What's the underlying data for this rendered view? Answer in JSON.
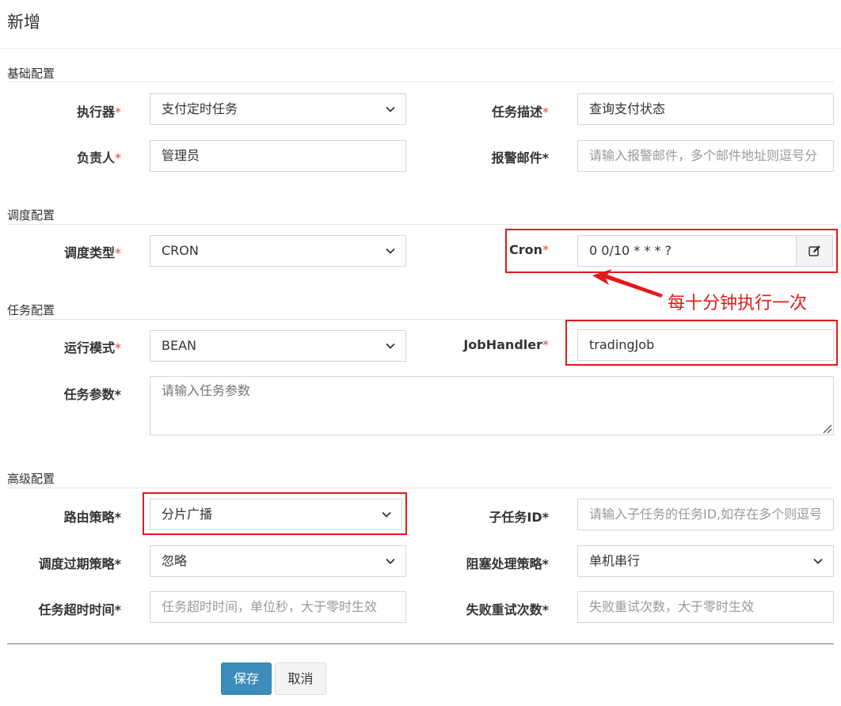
{
  "dialog": {
    "title": "新增"
  },
  "sections": {
    "basic": "基础配置",
    "schedule": "调度配置",
    "task": "任务配置",
    "advanced": "高级配置"
  },
  "required_mark": "*",
  "fields": {
    "executor": {
      "label": "执行器",
      "value": "支付定时任务"
    },
    "job_desc": {
      "label": "任务描述",
      "value": "查询支付状态"
    },
    "author": {
      "label": "负责人",
      "value": "管理员"
    },
    "alarm_email": {
      "label": "报警邮件",
      "placeholder": "请输入报警邮件，多个邮件地址则逗号分"
    },
    "schedule_type": {
      "label": "调度类型",
      "value": "CRON"
    },
    "cron": {
      "label": "Cron",
      "value": "0 0/10 * * * ?"
    },
    "glue_type": {
      "label": "运行模式",
      "value": "BEAN"
    },
    "job_handler": {
      "label": "JobHandler",
      "value": "tradingJob"
    },
    "job_param": {
      "label": "任务参数",
      "placeholder": "请输入任务参数"
    },
    "route_strategy": {
      "label": "路由策略",
      "value": "分片广播"
    },
    "child_job_id": {
      "label": "子任务ID",
      "placeholder": "请输入子任务的任务ID,如存在多个则逗号"
    },
    "misfire_strategy": {
      "label": "调度过期策略",
      "value": "忽略"
    },
    "block_strategy": {
      "label": "阻塞处理策略",
      "value": "单机串行"
    },
    "timeout": {
      "label": "任务超时时间",
      "placeholder": "任务超时时间，单位秒，大于零时生效"
    },
    "fail_retry": {
      "label": "失败重试次数",
      "placeholder": "失败重试次数，大于零时生效"
    }
  },
  "annotation": {
    "text": "每十分钟执行一次"
  },
  "buttons": {
    "save": "保存",
    "cancel": "取消"
  },
  "colors": {
    "primary": "#3c8dbc",
    "required": "#dd4b39",
    "annotation": "#e11a1a"
  },
  "icons": {
    "cron_edit": "edit-icon",
    "select_arrow": "chevron-down-icon"
  }
}
